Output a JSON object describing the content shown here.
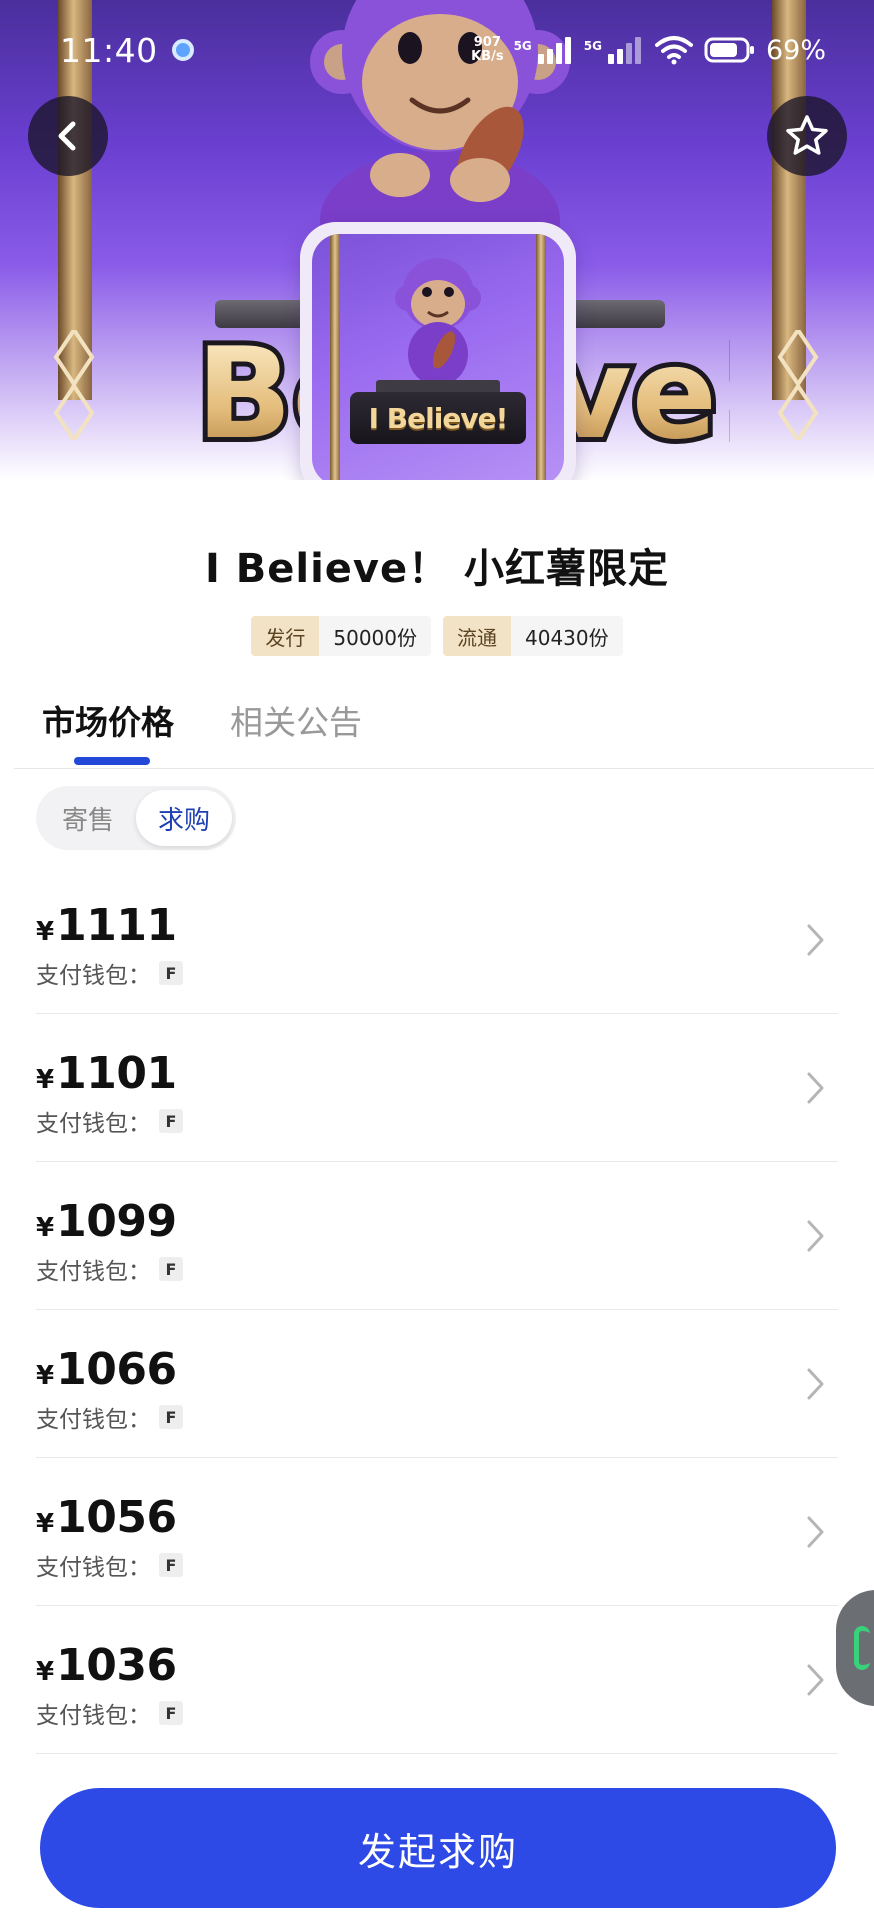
{
  "status_bar": {
    "time": "11:40",
    "net_speed_value": "907",
    "net_speed_unit": "KB/s",
    "sim1_type": "5G",
    "sim2_type": "5G",
    "battery_percent": "69%"
  },
  "hero": {
    "cover_word": "I Believe!",
    "banner_word": "I Believe!"
  },
  "product": {
    "title": "I Believe！ 小红薯限定",
    "stats": [
      {
        "key": "发行",
        "value": "50000份"
      },
      {
        "key": "流通",
        "value": "40430份"
      }
    ]
  },
  "tabs": [
    {
      "label": "市场价格",
      "active": true
    },
    {
      "label": "相关公告",
      "active": false
    }
  ],
  "segment": [
    {
      "label": "寄售",
      "active": false
    },
    {
      "label": "求购",
      "active": true
    }
  ],
  "listings": [
    {
      "currency": "¥",
      "price": "1111",
      "wallet_label": "支付钱包：",
      "wallet_badge": "F"
    },
    {
      "currency": "¥",
      "price": "1101",
      "wallet_label": "支付钱包：",
      "wallet_badge": "F"
    },
    {
      "currency": "¥",
      "price": "1099",
      "wallet_label": "支付钱包：",
      "wallet_badge": "F"
    },
    {
      "currency": "¥",
      "price": "1066",
      "wallet_label": "支付钱包：",
      "wallet_badge": "F"
    },
    {
      "currency": "¥",
      "price": "1056",
      "wallet_label": "支付钱包：",
      "wallet_badge": "F"
    },
    {
      "currency": "¥",
      "price": "1036",
      "wallet_label": "支付钱包：",
      "wallet_badge": "F"
    }
  ],
  "cta": {
    "label": "发起求购"
  },
  "colors": {
    "accent": "#2d49e6",
    "tag_bg": "#f3e3c6",
    "hero_purple": "#6a3fd0"
  },
  "icons": {
    "back": "chevron-left-icon",
    "favorite": "star-icon",
    "row": "chevron-right-icon"
  }
}
